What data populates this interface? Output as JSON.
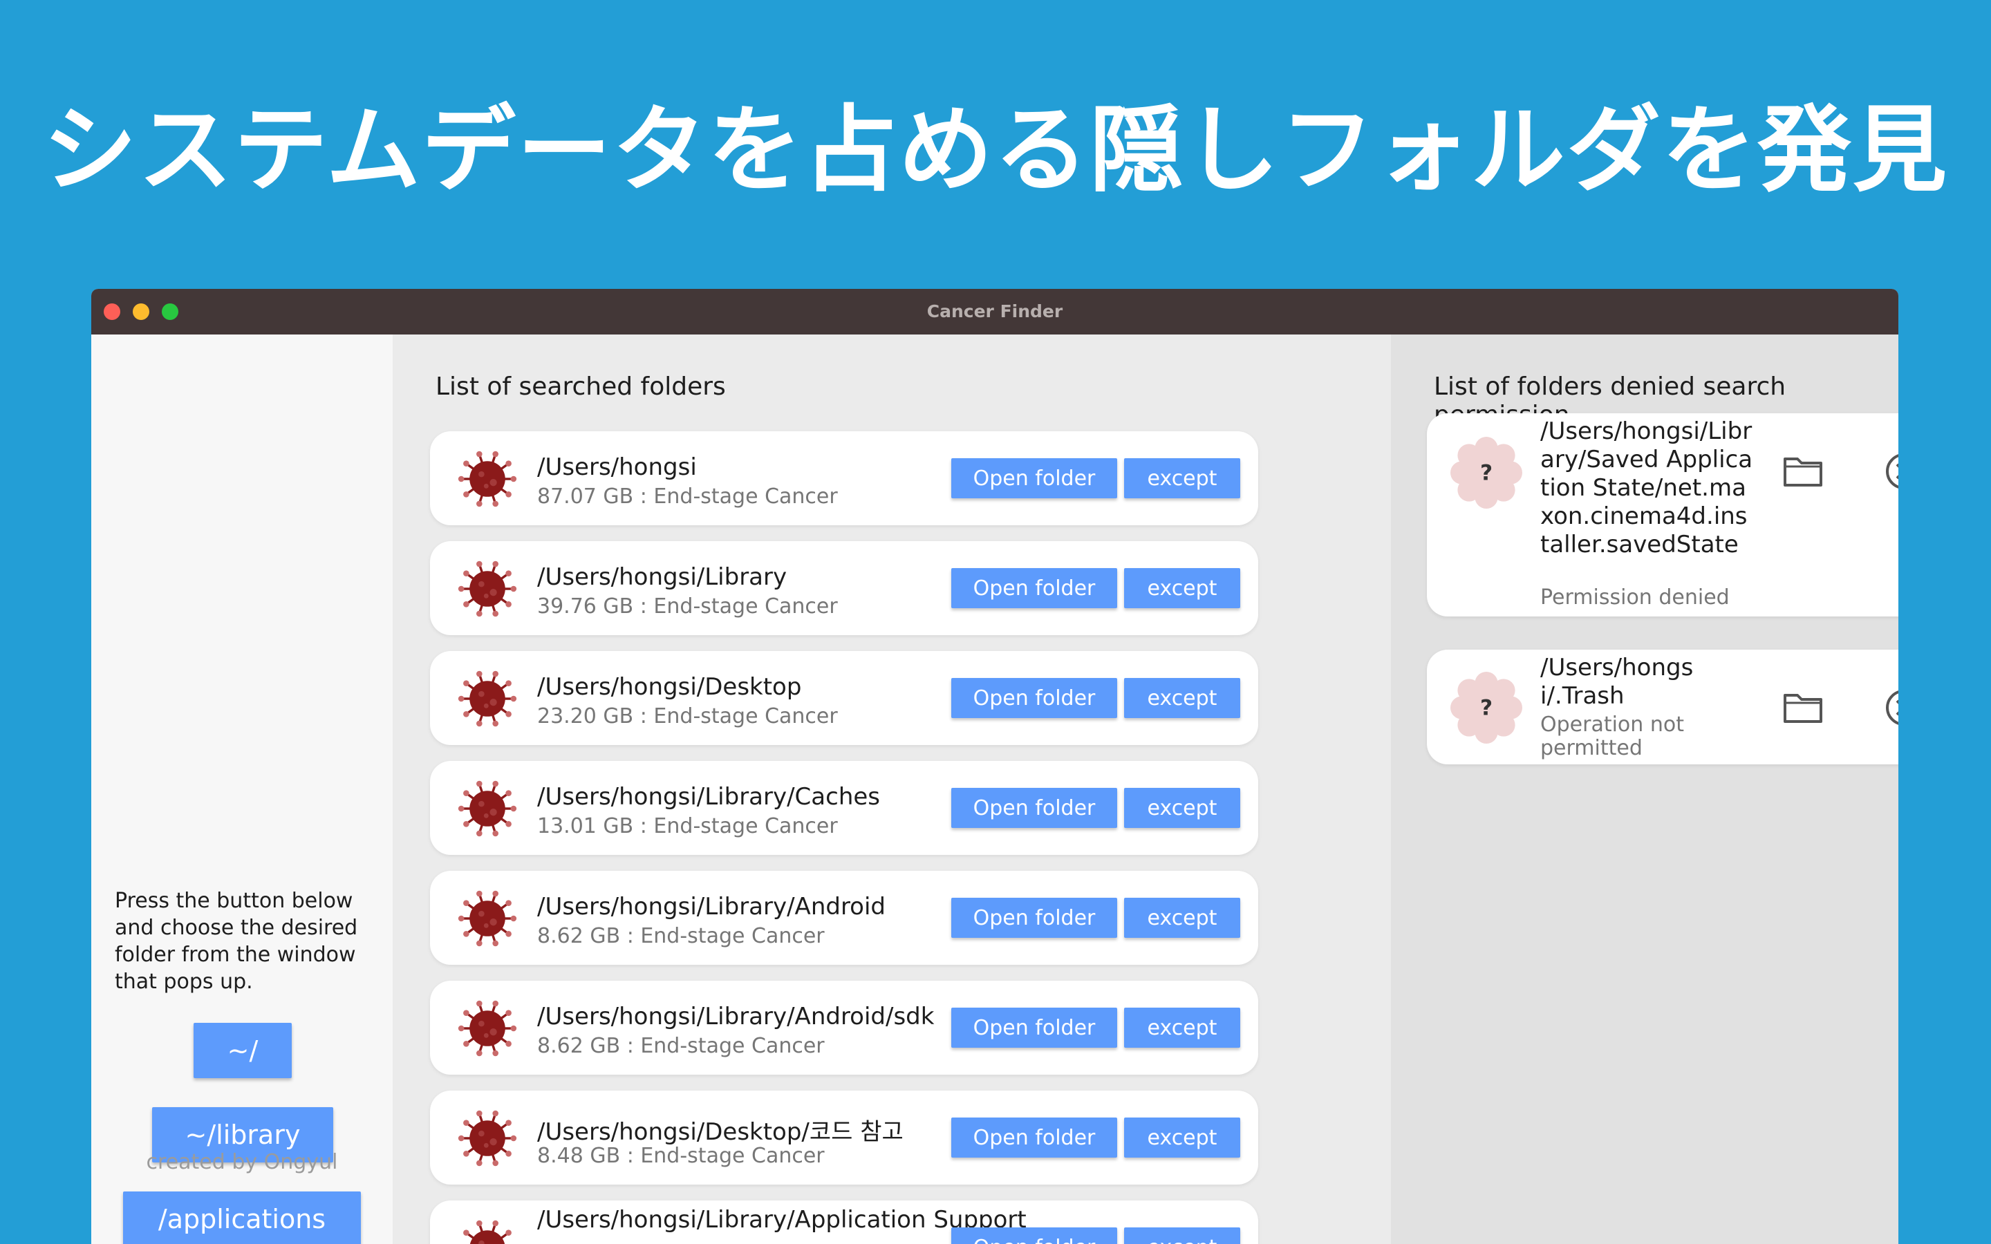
{
  "headline": "システムデータを占める隠しフォルダを発見",
  "window": {
    "title": "Cancer Finder"
  },
  "sidebar": {
    "instructions": "Press the button below and choose the desired folder from the window that pops up.",
    "buttons": [
      "~/",
      "~/library",
      "/applications"
    ],
    "credit": "created by Ongyul"
  },
  "searched": {
    "title": "List of searched folders",
    "open_label": "Open folder",
    "except_label": "except",
    "items": [
      {
        "path": "/Users/hongsi",
        "size": "87.07 GB : End-stage Cancer"
      },
      {
        "path": "/Users/hongsi/Library",
        "size": "39.76 GB : End-stage Cancer"
      },
      {
        "path": "/Users/hongsi/Desktop",
        "size": "23.20 GB : End-stage Cancer"
      },
      {
        "path": "/Users/hongsi/Library/Caches",
        "size": "13.01 GB : End-stage Cancer"
      },
      {
        "path": "/Users/hongsi/Library/Android",
        "size": "8.62 GB : End-stage Cancer"
      },
      {
        "path": "/Users/hongsi/Library/Android/sdk",
        "size": "8.62 GB : End-stage Cancer"
      },
      {
        "path": "/Users/hongsi/Desktop/코드 참고",
        "size": "8.48 GB : End-stage Cancer"
      },
      {
        "path": "/Users/hongsi/Library/Application Support",
        "size": ""
      }
    ]
  },
  "denied": {
    "title": "List of folders denied search permission",
    "items": [
      {
        "path": "/Users/hongsi/Library/Saved Application State/net.maxon.cinema4d.installer.savedState",
        "reason": "Permission denied",
        "badge": "?"
      },
      {
        "path": "/Users/hongsi/.Trash",
        "reason": "Operation not permitted",
        "badge": "?"
      }
    ]
  },
  "colors": {
    "accent": "#5d9bfc",
    "background": "#239ed6",
    "virus": "#8b1a1a",
    "badge": "#f0d4d4"
  },
  "icons": {
    "item": "virus-icon",
    "badge": "question-badge-icon",
    "folder": "folder-icon",
    "remove": "close-circle-icon"
  }
}
